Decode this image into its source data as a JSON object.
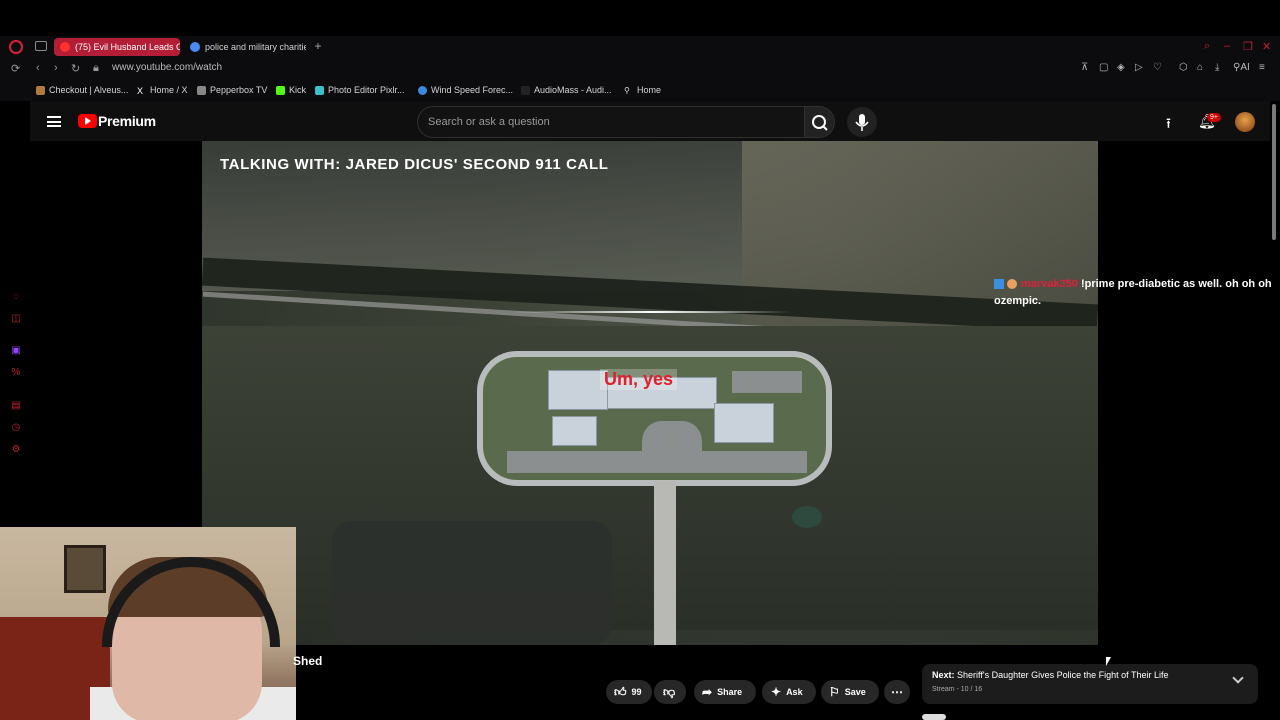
{
  "browser": {
    "tabs": [
      {
        "label": "(75) Evil Husband Leads C",
        "active": true
      },
      {
        "label": "police and military charitie",
        "active": false
      }
    ],
    "url": "www.youtube.com/watch",
    "bookmarks": [
      {
        "label": "Checkout | Alveus...",
        "icon": "bookmark-icon"
      },
      {
        "label": "Home / X",
        "icon": "x-icon"
      },
      {
        "label": "Pepperbox TV",
        "icon": "tv-icon"
      },
      {
        "label": "Kick",
        "icon": "kick-icon"
      },
      {
        "label": "Photo Editor Pixlr...",
        "icon": "photo-icon"
      },
      {
        "label": "Wind Speed Forec...",
        "icon": "wind-icon"
      },
      {
        "label": "AudioMass - Audi...",
        "icon": "audio-icon"
      },
      {
        "label": "Home",
        "icon": "pin-icon"
      }
    ],
    "ext_ai_label": "AI",
    "accent_color": "#b31d36"
  },
  "youtube": {
    "brand": "Premium",
    "search_placeholder": "Search or ask a question",
    "notification_count": "9+"
  },
  "video": {
    "caption": "TALKING WITH: JARED DICUS' SECOND 911 CALL",
    "subtitle": "Um, yes",
    "chat": {
      "username": "marvak350",
      "message": "!prime pre-diabetic as well. oh oh oh ozempic."
    }
  },
  "below": {
    "title_fragment": "Shed",
    "like_count": "99",
    "share_label": "Share",
    "ask_label": "Ask",
    "save_label": "Save",
    "next_label": "Next:",
    "next_title": "Sheriff's Daughter Gives Police the Fight of Their Life",
    "next_sub": "Stream - 10 / 16"
  }
}
